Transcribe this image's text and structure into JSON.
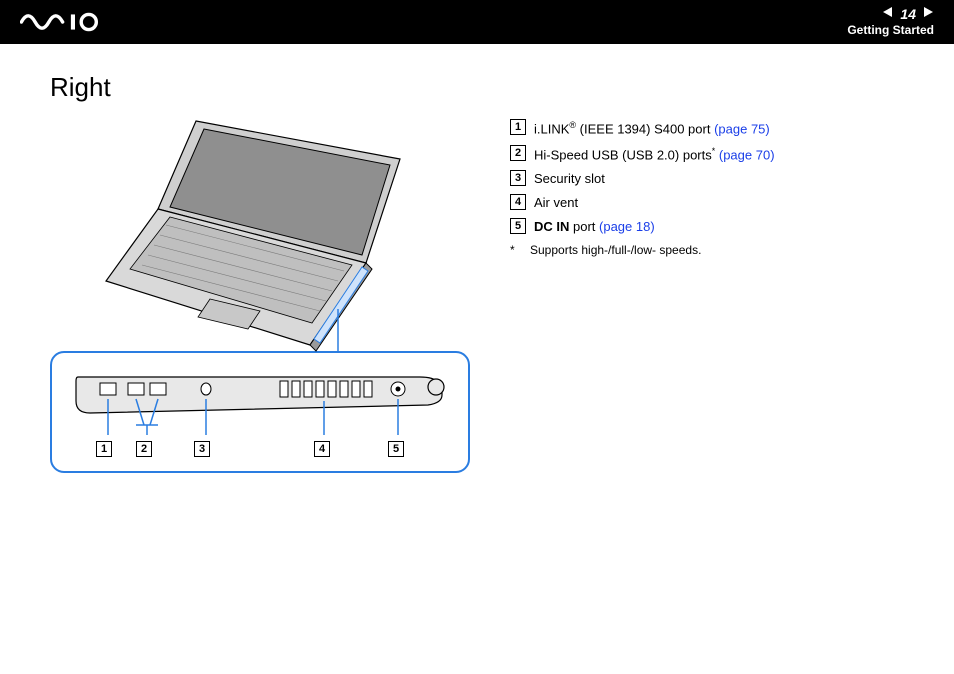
{
  "header": {
    "page_number": "14",
    "section": "Getting Started"
  },
  "title": "Right",
  "items": [
    {
      "num": "1",
      "prefix": "i.LINK",
      "sup": "®",
      "mid": " (IEEE 1394) S400 port ",
      "link": "(page 75)"
    },
    {
      "num": "2",
      "prefix": "Hi-Speed USB (USB 2.0) ports",
      "sup": "*",
      "mid": " ",
      "link": "(page 70)"
    },
    {
      "num": "3",
      "prefix": "Security slot",
      "sup": "",
      "mid": "",
      "link": ""
    },
    {
      "num": "4",
      "prefix": "Air vent",
      "sup": "",
      "mid": "",
      "link": ""
    },
    {
      "num": "5",
      "prefix_bold": "DC IN",
      "prefix": " port ",
      "sup": "",
      "mid": "",
      "link": "(page 18)"
    }
  ],
  "footnote": {
    "mark": "*",
    "text": "Supports high-/full-/low- speeds."
  },
  "callout_numbers": [
    "1",
    "2",
    "3",
    "4",
    "5"
  ]
}
